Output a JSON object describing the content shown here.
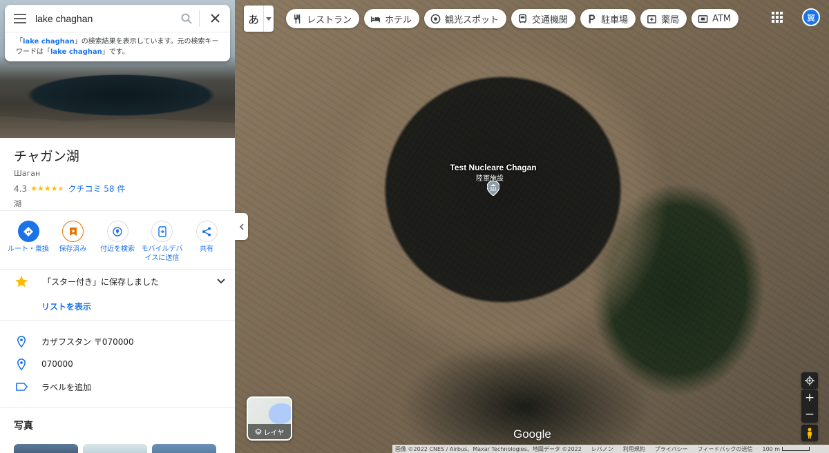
{
  "search": {
    "query": "lake chaghan",
    "note_prefix": "「",
    "note_term": "lake chaghan",
    "note_mid": "」の検索結果を表示しています。元の検索キーワードは「",
    "note_term2": "lake chaghan",
    "note_suffix": "」です。"
  },
  "place": {
    "title": "チャガン湖",
    "subtitle": "Шаган",
    "rating": "4.3",
    "stars": 4.3,
    "reviews": "クチコミ 58 件",
    "type": "湖"
  },
  "actions": [
    {
      "label": "ルート・乗換"
    },
    {
      "label": "保存済み"
    },
    {
      "label": "付近を検索"
    },
    {
      "label": "モバイルデバイスに送信"
    },
    {
      "label": "共有"
    }
  ],
  "saved": {
    "text": "「スター付き」に保存しました",
    "link": "リストを表示"
  },
  "info": {
    "address": "カザフスタン 〒070000",
    "postal": "070000",
    "label": "ラベルを追加"
  },
  "photos": {
    "title": "写真"
  },
  "map": {
    "lang": "あ",
    "chips": [
      "レストラン",
      "ホテル",
      "観光スポット",
      "交通機関",
      "駐車場",
      "薬局",
      "ATM"
    ],
    "pin_title": "Test Nucleare Chagan",
    "pin_sub": "陸軍施設",
    "avatar": "翼",
    "layer": "レイヤ",
    "google": "Google",
    "attribution": [
      "画像 ©2022 CNES / Airbus、Maxar Technologies、地図データ ©2022",
      "レバノン",
      "利用規約",
      "プライバシー",
      "フィードバックの送信"
    ],
    "scale": "100 m"
  },
  "colors": {
    "accent": "#1a73e8",
    "star": "#fbbc04"
  }
}
